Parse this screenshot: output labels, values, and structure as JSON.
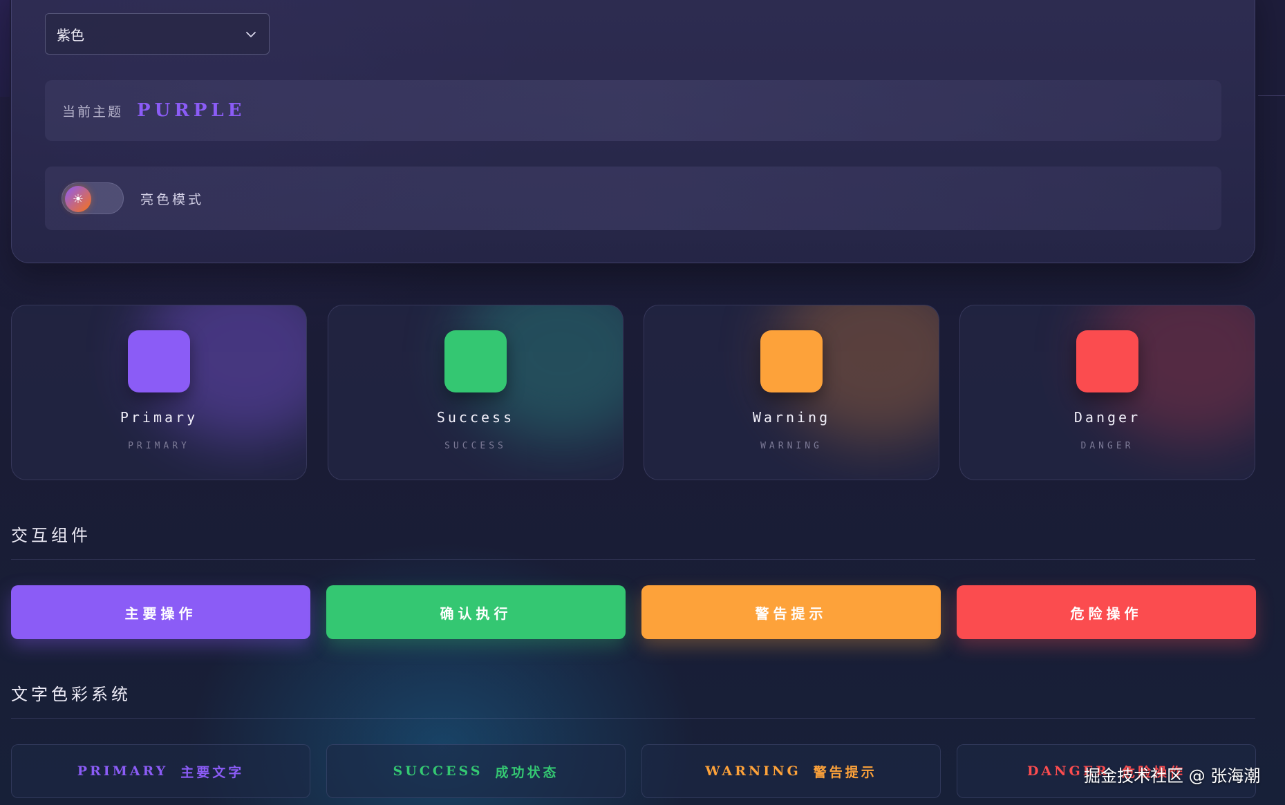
{
  "theme_selector": {
    "selected": "紫色"
  },
  "current_theme": {
    "label": "当前主题",
    "value": "PURPLE"
  },
  "mode_toggle": {
    "knob_glyph": "☀",
    "label": "亮色模式"
  },
  "color_cards": [
    {
      "name": "Primary",
      "sub": "PRIMARY",
      "color": "#8b5cf6"
    },
    {
      "name": "Success",
      "sub": "SUCCESS",
      "color": "#34c772"
    },
    {
      "name": "Warning",
      "sub": "WARNING",
      "color": "#fda23a"
    },
    {
      "name": "Danger",
      "sub": "DANGER",
      "color": "#fb4c4f"
    }
  ],
  "sections": {
    "interactive_title": "交互组件",
    "text_color_title": "文字色彩系统"
  },
  "action_buttons": [
    {
      "label": "主要操作",
      "color": "#8b5cf6"
    },
    {
      "label": "确认执行",
      "color": "#34c772"
    },
    {
      "label": "警告提示",
      "color": "#fda23a"
    },
    {
      "label": "危险操作",
      "color": "#fb4c4f"
    }
  ],
  "text_samples": [
    {
      "en": "PRIMARY",
      "zh": "主要文字",
      "color": "#8b5cf6"
    },
    {
      "en": "SUCCESS",
      "zh": "成功状态",
      "color": "#34c772"
    },
    {
      "en": "WARNING",
      "zh": "警告提示",
      "color": "#fda23a"
    },
    {
      "en": "DANGER",
      "zh": "危险操作",
      "color": "#fb4c4f"
    }
  ],
  "watermark": "掘金技术社区 @ 张海潮"
}
